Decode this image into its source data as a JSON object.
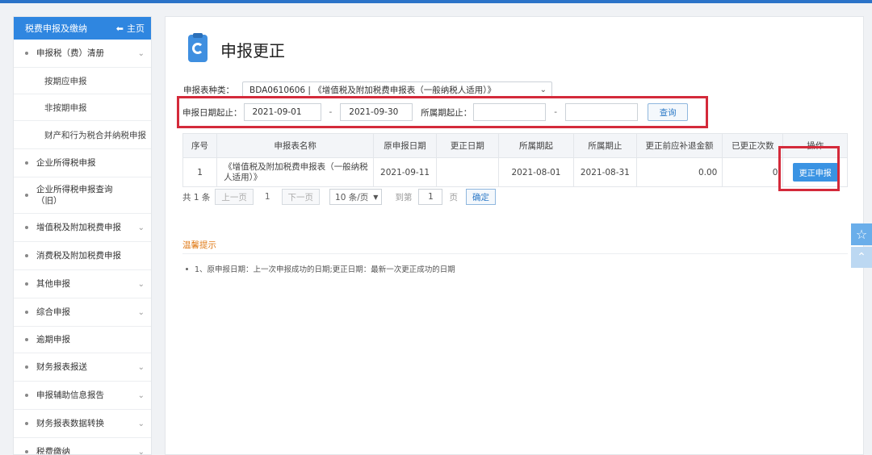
{
  "sidebar": {
    "header_title": "税费申报及缴纳",
    "home_label": "主页",
    "items": [
      {
        "label": "申报税（费）清册",
        "has_chevron": true
      },
      {
        "label": "按期应申报",
        "sub": true
      },
      {
        "label": "非按期申报",
        "sub": true
      },
      {
        "label": "财产和行为税合并纳税申报",
        "sub": true
      },
      {
        "label": "企业所得税申报",
        "has_chevron": false
      },
      {
        "label": "企业所得税申报查询（旧）",
        "has_chevron": false
      },
      {
        "label": "增值税及附加税费申报",
        "has_chevron": true
      },
      {
        "label": "消费税及附加税费申报",
        "has_chevron": false
      },
      {
        "label": "其他申报",
        "has_chevron": true
      },
      {
        "label": "综合申报",
        "has_chevron": true
      },
      {
        "label": "逾期申报",
        "has_chevron": false
      },
      {
        "label": "财务报表报送",
        "has_chevron": true
      },
      {
        "label": "申报辅助信息报告",
        "has_chevron": true
      },
      {
        "label": "财务报表数据转换",
        "has_chevron": true
      },
      {
        "label": "税费缴纳",
        "has_chevron": true
      }
    ]
  },
  "page": {
    "title": "申报更正",
    "form_type_label": "申报表种类：",
    "form_type_value": "BDA0610606 | 《增值税及附加税费申报表（一般纳税人适用）》"
  },
  "filter": {
    "date_label": "申报日期起止：",
    "date_start": "2021-09-01",
    "date_end": "2021-09-30",
    "dash": "-",
    "period_label": "所属期起止：",
    "period_start": "",
    "period_end": "",
    "query_label": "查询"
  },
  "table": {
    "headers": [
      "序号",
      "申报表名称",
      "原申报日期",
      "更正日期",
      "所属期起",
      "所属期止",
      "更正前应补退金额",
      "已更正次数",
      "操作"
    ],
    "rows": [
      {
        "index": "1",
        "name": "《增值税及附加税费申报表（一般纳税人适用）》",
        "orig_date": "2021-09-11",
        "amend_date": "",
        "period_start": "2021-08-01",
        "period_end": "2021-08-31",
        "amount": "0.00",
        "count": "0",
        "action": "更正申报"
      }
    ]
  },
  "pager": {
    "total": "共 1 条",
    "prev": "上一页",
    "page": "1",
    "next": "下一页",
    "page_size": "10 条/页",
    "goto_label": "到第",
    "goto_value": "1",
    "page_unit": "页",
    "confirm": "确定"
  },
  "tips": {
    "title": "温馨提示",
    "items": [
      "1、原申报日期：上一次申报成功的日期;更正日期：最新一次更正成功的日期"
    ]
  },
  "float": {
    "star_icon": "star-icon",
    "up_icon": "arrow-up-icon"
  }
}
